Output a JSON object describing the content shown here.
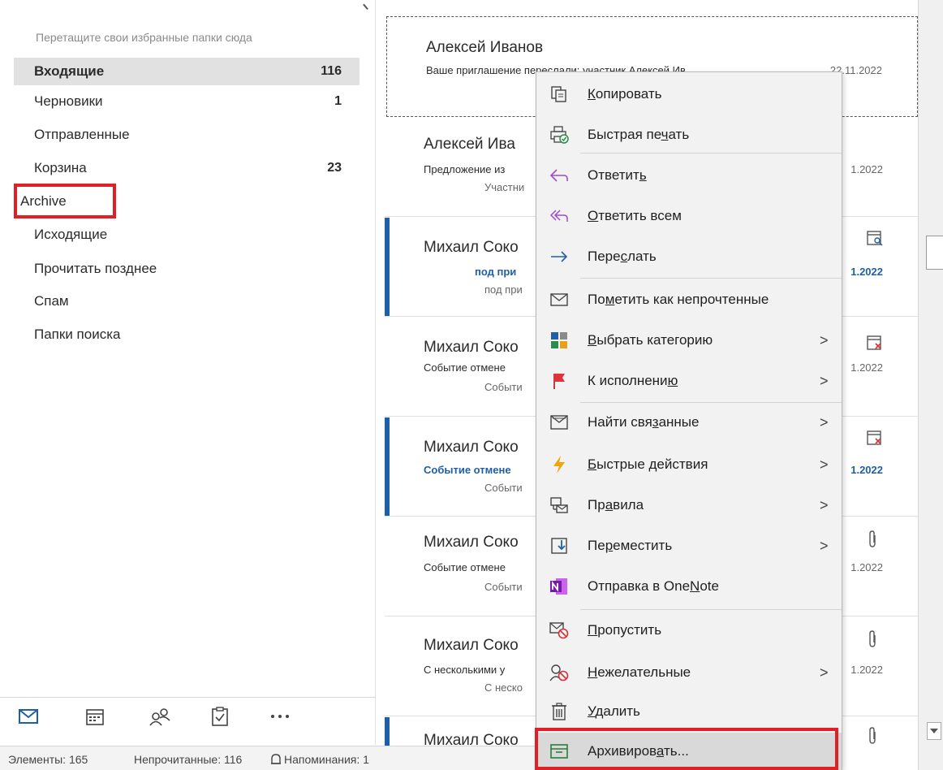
{
  "folder_pane": {
    "favorites_hint": "Перетащите свои избранные папки сюда",
    "folders": [
      {
        "name": "Входящие",
        "count": "116",
        "selected": true
      },
      {
        "name": "Черновики",
        "count": "1"
      },
      {
        "name": "Отправленные",
        "count": ""
      },
      {
        "name": "Корзина",
        "count": "23"
      },
      {
        "name": "Archive",
        "count": ""
      },
      {
        "name": "Исходящие",
        "count": ""
      },
      {
        "name": "Прочитать позднее",
        "count": ""
      },
      {
        "name": "Спам",
        "count": ""
      },
      {
        "name": "Папки поиска",
        "count": ""
      }
    ],
    "nav_icons": [
      "mail-icon",
      "calendar-icon",
      "people-icon",
      "tasks-icon",
      "more-icon"
    ]
  },
  "status_bar": {
    "items": "Элементы: 165",
    "unread": "Непрочитанные: 116",
    "reminders": "Напоминания: 1"
  },
  "message_list": {
    "messages": [
      {
        "sender": "Алексей Иванов",
        "subject": "Ваше приглашение переслали: участник Алексей Ив...",
        "preview": "",
        "date": "22.11.2022",
        "unread": false,
        "icon": ""
      },
      {
        "sender": "Алексей Ива",
        "subject": "Предложение из",
        "preview": "Участни",
        "date": "1.2022",
        "unread": false,
        "icon": ""
      },
      {
        "sender": "Михаил Соко",
        "subject": "под при",
        "preview": "под при",
        "date": "1.2022",
        "unread": true,
        "icon": "calendar-search-icon"
      },
      {
        "sender": "Михаил Соко",
        "subject": "Событие отмене",
        "preview": "Событи",
        "date": "1.2022",
        "unread": false,
        "icon": "calendar-cancel-icon"
      },
      {
        "sender": "Михаил Соко",
        "subject": "Событие отмене",
        "preview": "Событи",
        "date": "1.2022",
        "unread": true,
        "icon": "calendar-cancel-icon"
      },
      {
        "sender": "Михаил Соко",
        "subject": "Событие отмене",
        "preview": "Событи",
        "date": "1.2022",
        "unread": false,
        "icon": "paperclip-icon"
      },
      {
        "sender": "Михаил Соко",
        "subject": "С несколькими у",
        "preview": "С неско",
        "date": "1.2022",
        "unread": false,
        "icon": "paperclip-icon"
      },
      {
        "sender": "Михаил Соко",
        "subject": "",
        "preview": "",
        "date": "",
        "unread": true,
        "icon": "paperclip-icon"
      }
    ]
  },
  "context_menu": {
    "items": [
      {
        "pre": "",
        "ul": "К",
        "post": "опировать",
        "icon": "copy-icon",
        "submenu": false
      },
      {
        "pre": "Быстрая пе",
        "ul": "ч",
        "post": "ать",
        "icon": "quick-print-icon",
        "submenu": false
      },
      {
        "pre": "Ответит",
        "ul": "ь",
        "post": "",
        "icon": "reply-icon",
        "submenu": false
      },
      {
        "pre": "",
        "ul": "О",
        "post": "тветить всем",
        "icon": "reply-all-icon",
        "submenu": false
      },
      {
        "pre": "Пере",
        "ul": "с",
        "post": "лать",
        "icon": "forward-icon",
        "submenu": false
      },
      {
        "pre": "По",
        "ul": "м",
        "post": "етить как непрочтенные",
        "icon": "envelope-icon",
        "submenu": false
      },
      {
        "pre": "",
        "ul": "В",
        "post": "ыбрать категорию",
        "icon": "category-icon",
        "submenu": true
      },
      {
        "pre": "К исполнени",
        "ul": "ю",
        "post": "",
        "icon": "flag-icon",
        "submenu": true
      },
      {
        "pre": "Найти свя",
        "ul": "з",
        "post": "анные",
        "icon": "find-related-icon",
        "submenu": true
      },
      {
        "pre": "",
        "ul": "Б",
        "post": "ыстрые действия",
        "icon": "lightning-icon",
        "submenu": true
      },
      {
        "pre": "Пр",
        "ul": "а",
        "post": "вила",
        "icon": "rules-icon",
        "submenu": true
      },
      {
        "pre": "Пе",
        "ul": "р",
        "post": "еместить",
        "icon": "move-icon",
        "submenu": true
      },
      {
        "pre": "Отправка в One",
        "ul": "N",
        "post": "ote",
        "icon": "onenote-icon",
        "submenu": false
      },
      {
        "pre": "",
        "ul": "П",
        "post": "ропустить",
        "icon": "ignore-icon",
        "submenu": false
      },
      {
        "pre": "",
        "ul": "Н",
        "post": "ежелательные",
        "icon": "junk-icon",
        "submenu": true
      },
      {
        "pre": "",
        "ul": "У",
        "post": "далить",
        "icon": "delete-icon",
        "submenu": false
      },
      {
        "pre": "Архивиров",
        "ul": "а",
        "post": "ть...",
        "icon": "archive-icon",
        "submenu": false,
        "highlight": true
      }
    ],
    "submenu_arrow": ">"
  },
  "colors": {
    "accent": "#1f5fa8",
    "highlight_box": "#e01f27",
    "menu_bg": "#f2f2f2"
  }
}
